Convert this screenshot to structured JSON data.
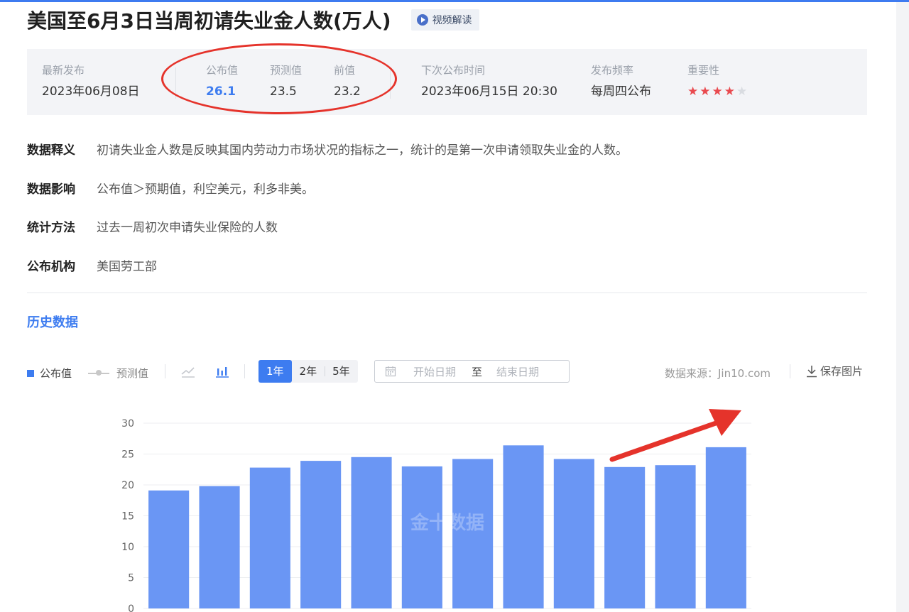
{
  "header": {
    "title": "美国至6月3日当周初请失业金人数(万人)",
    "video_label": "视频解读"
  },
  "info": {
    "latest_label": "最新发布",
    "latest_value": "2023年06月08日",
    "actual_label": "公布值",
    "actual_value": "26.1",
    "forecast_label": "预测值",
    "forecast_value": "23.5",
    "previous_label": "前值",
    "previous_value": "23.2",
    "next_label": "下次公布时间",
    "next_value": "2023年06月15日 20:30",
    "freq_label": "发布频率",
    "freq_value": "每周四公布",
    "importance_label": "重要性",
    "importance_stars": 4,
    "importance_max": 5
  },
  "definitions": [
    {
      "label": "数据释义",
      "text": "初请失业金人数是反映其国内劳动力市场状况的指标之一，统计的是第一次申请领取失业金的人数。"
    },
    {
      "label": "数据影响",
      "text": "公布值＞预期值，利空美元，利多非美。"
    },
    {
      "label": "统计方法",
      "text": "过去一周初次申请失业保险的人数"
    },
    {
      "label": "公布机构",
      "text": "美国劳工部"
    }
  ],
  "history_title": "历史数据",
  "toolbar": {
    "legend_actual": "公布值",
    "legend_forecast": "预测值",
    "ranges": [
      "1年",
      "2年",
      "5年"
    ],
    "active_range": "1年",
    "date_start_placeholder": "开始日期",
    "date_to": "至",
    "date_end_placeholder": "结束日期",
    "source": "数据来源：Jin10.com",
    "save_label": "保存图片"
  },
  "colors": {
    "accent": "#3d7cf0",
    "bar": "#6a96f4",
    "star_on": "#e94a4f",
    "star_off": "#d9dce1",
    "annotation": "#e5332b"
  },
  "chart_data": {
    "type": "bar",
    "series": [
      {
        "name": "公布值",
        "values": [
          19.1,
          19.8,
          22.8,
          23.9,
          24.5,
          23.0,
          24.2,
          26.4,
          24.2,
          22.9,
          23.2,
          26.1
        ]
      }
    ],
    "ylim": [
      0,
      30
    ],
    "yticks": [
      "0",
      "5",
      "10",
      "15",
      "20",
      "25",
      "30"
    ],
    "grid": true,
    "watermark": "金十数据"
  }
}
